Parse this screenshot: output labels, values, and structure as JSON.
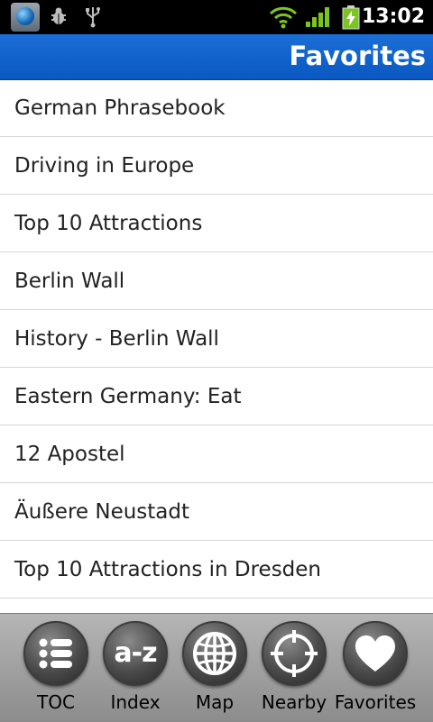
{
  "status_bar": {
    "time": "13:02",
    "icons": [
      "app-globe-icon",
      "debug-bug-icon",
      "usb-icon",
      "wifi-icon",
      "signal-icon",
      "battery-charging-icon"
    ]
  },
  "header": {
    "title": "Favorites"
  },
  "favorites": {
    "items": [
      "German Phrasebook",
      "Driving in Europe",
      "Top 10 Attractions",
      "Berlin Wall",
      "History - Berlin Wall",
      "Eastern Germany: Eat",
      "12 Apostel",
      "Äußere Neustadt",
      "Top 10 Attractions in Dresden"
    ]
  },
  "toolbar": {
    "buttons": [
      {
        "label": "TOC",
        "icon": "list-icon"
      },
      {
        "label": "Index",
        "icon": "a-z-icon",
        "icon_text": "a-z"
      },
      {
        "label": "Map",
        "icon": "globe-icon"
      },
      {
        "label": "Nearby",
        "icon": "crosshair-icon"
      },
      {
        "label": "Favorites",
        "icon": "heart-icon"
      }
    ]
  },
  "colors": {
    "title_bar": "#0a58c2",
    "status_bar": "#000000",
    "signal_green": "#7cc41f",
    "toolbar": "#a0a0a0"
  }
}
